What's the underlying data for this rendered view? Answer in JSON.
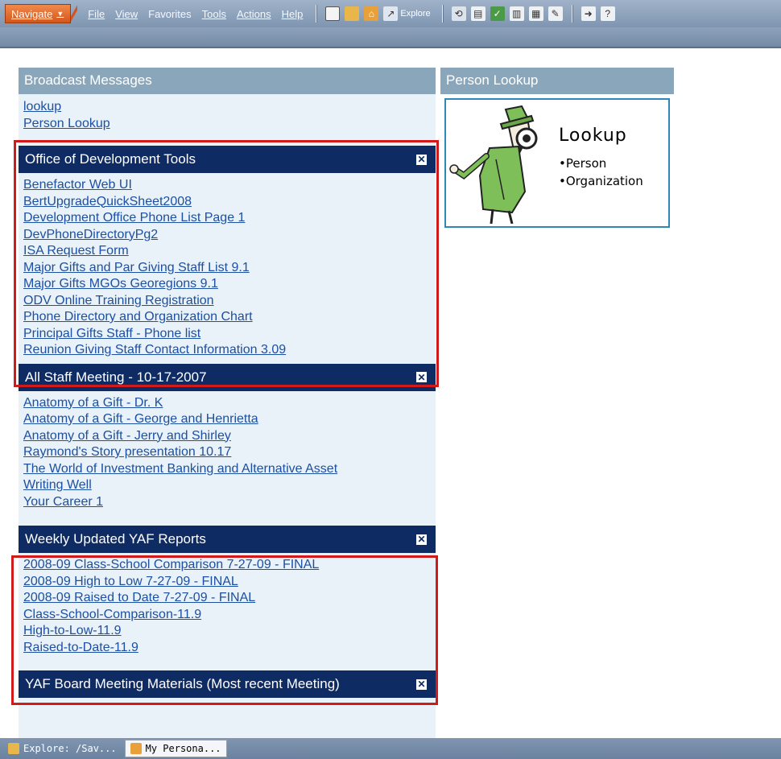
{
  "menubar": {
    "navigate_label": "Navigate",
    "items": [
      "File",
      "View",
      "Favorites",
      "Tools",
      "Actions",
      "Help"
    ],
    "explore_label": "Explore"
  },
  "broadcast": {
    "title": "Broadcast Messages",
    "links": [
      "lookup",
      "Person Lookup"
    ]
  },
  "person_lookup": {
    "title": "Person Lookup",
    "card_title": "Lookup",
    "card_items": [
      "•Person",
      "•Organization"
    ]
  },
  "sections": [
    {
      "title": "Office of Development Tools",
      "links": [
        "Benefactor Web UI",
        "BertUpgradeQuickSheet2008",
        "Development Office Phone List Page 1",
        "DevPhoneDirectoryPg2",
        "ISA Request Form",
        "Major Gifts and Par Giving Staff List 9.1",
        "Major Gifts MGOs Georegions 9.1",
        "ODV Online Training Registration",
        "Phone Directory and Organization Chart",
        "Principal Gifts Staff - Phone list",
        "Reunion Giving Staff Contact Information 3.09"
      ]
    },
    {
      "title": "All Staff Meeting - 10-17-2007",
      "links": [
        "Anatomy of a Gift - Dr. K",
        "Anatomy of a Gift - George and Henrietta",
        "Anatomy of a Gift - Jerry and Shirley",
        "Raymond's Story presentation 10.17",
        "The World of Investment Banking and Alternative Asset",
        "Writing Well",
        "Your Career 1"
      ]
    },
    {
      "title": "Weekly Updated YAF Reports",
      "links": [
        "2008-09 Class-School Comparison 7-27-09 - FINAL",
        "2008-09 High to Low 7-27-09 - FINAL",
        "2008-09 Raised to Date 7-27-09 - FINAL",
        "Class-School-Comparison-11.9",
        "High-to-Low-11.9",
        "Raised-to-Date-11.9"
      ]
    },
    {
      "title": "YAF Board Meeting Materials (Most recent Meeting)",
      "links": []
    }
  ],
  "taskbar": {
    "tasks": [
      "Explore: /Sav...",
      "My Persona..."
    ]
  },
  "colors": {
    "section_header": "#0e2b63",
    "highlight_border": "#d11b1b",
    "link": "#1d4fa2"
  }
}
